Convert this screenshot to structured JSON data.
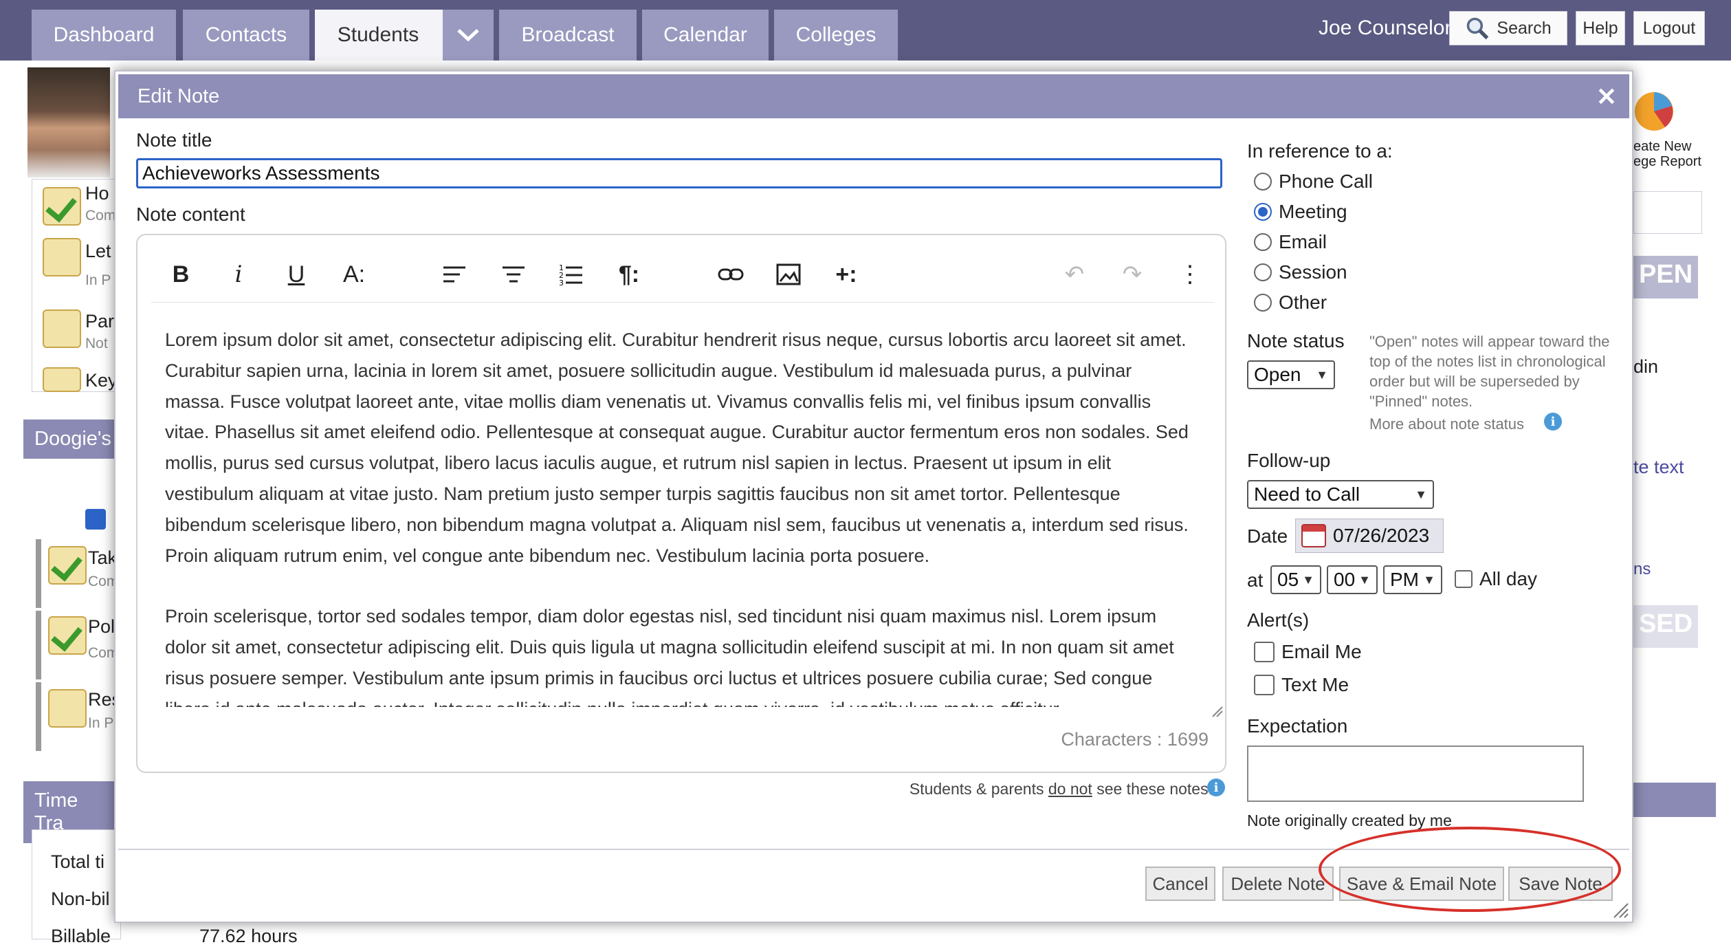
{
  "nav": {
    "tabs": [
      "Dashboard",
      "Contacts",
      "Students",
      "Broadcast",
      "Calendar",
      "Colleges"
    ],
    "active_tab": "Students",
    "user_name": "Joe Counselor",
    "search_label": "Search",
    "help_label": "Help",
    "logout_label": "Logout"
  },
  "background": {
    "tasks_top": [
      {
        "title": "Ho",
        "sub": "Com"
      },
      {
        "title": "Let",
        "sub": "In P"
      },
      {
        "title": "Par",
        "sub": "Not"
      },
      {
        "title": "Key",
        "sub": ""
      }
    ],
    "section2_title": "Doogie's",
    "tasks_mid": [
      {
        "title": "Tak",
        "sub": "Com"
      },
      {
        "title": "Pol",
        "sub": "Com"
      },
      {
        "title": "Res",
        "sub": "In P"
      }
    ],
    "section3_title": "Time Tra",
    "time_rows": [
      "Total ti",
      "Non-bil",
      "Billable",
      "77.62 hours"
    ],
    "right": {
      "report_line1": "eate New",
      "report_line2": "ege Report",
      "open_badge": "PEN",
      "closed_badge": "SED",
      "din_text": "din",
      "te_text": "te text",
      "ns_text": "ns"
    }
  },
  "modal": {
    "title": "Edit Note",
    "close_symbol": "✕",
    "note_title_label": "Note title",
    "note_title_value": "Achieveworks Assessments",
    "note_content_label": "Note content",
    "toolbar_icons": [
      "bold-icon",
      "italic-icon",
      "underline-icon",
      "font-size-icon",
      "align-left-icon",
      "align-center-icon",
      "ordered-list-icon",
      "paragraph-format-icon",
      "link-icon",
      "image-icon",
      "insert-more-icon",
      "undo-icon",
      "redo-icon",
      "more-icon"
    ],
    "content_paragraphs": [
      "Lorem ipsum dolor sit amet, consectetur adipiscing elit. Curabitur hendrerit risus neque, cursus lobortis arcu laoreet sit amet. Curabitur sapien urna, lacinia in lorem sit amet, posuere sollicitudin augue. Vestibulum id malesuada purus, a pulvinar massa. Fusce volutpat laoreet ante, vitae mollis diam venenatis ut. Vivamus convallis felis mi, vel finibus ipsum convallis vitae. Phasellus sit amet eleifend odio. Pellentesque at consequat augue. Curabitur auctor fermentum eros non sodales. Sed mollis, purus sed cursus volutpat, libero lacus iaculis augue, et rutrum nisl sapien in lectus. Praesent ut ipsum in elit vestibulum aliquam at vitae justo. Nam pretium justo semper turpis sagittis faucibus non sit amet tortor. Pellentesque bibendum scelerisque libero, non bibendum magna volutpat a. Aliquam nisl sem, faucibus ut venenatis a, interdum sed risus. Proin aliquam rutrum enim, vel congue ante bibendum nec. Vestibulum lacinia porta posuere.",
      "Proin scelerisque, tortor sed sodales tempor, diam dolor egestas nisl, sed tincidunt nisi quam maximus nisl. Lorem ipsum dolor sit amet, consectetur adipiscing elit. Duis quis ligula ut magna sollicitudin eleifend suscipit at mi. In non quam sit amet risus posuere semper. Vestibulum ante ipsum primis in faucibus orci luctus et ultrices posuere cubilia curae; Sed congue libero id ante malesuada auctor. Integer sollicitudin nulla imperdiet quam viverra, id vestibulum metus efficitur."
    ],
    "char_count": "Characters : 1699",
    "footnote_pre": "Students & parents ",
    "footnote_u": "do not",
    "footnote_post": " see these notes.",
    "reference_label": "In reference to a:",
    "reference_options": [
      "Phone Call",
      "Meeting",
      "Email",
      "Session",
      "Other"
    ],
    "reference_selected": "Meeting",
    "status_label": "Note status",
    "status_value": "Open",
    "status_note": "\"Open\" notes will appear toward the top of the notes list in chronological order but will be superseded by \"Pinned\" notes.",
    "status_more": "More about note status",
    "followup_label": "Follow-up",
    "followup_value": "Need to Call",
    "date_label": "Date",
    "date_value": "07/26/2023",
    "at_label": "at",
    "hour": "05",
    "minute": "00",
    "ampm": "PM",
    "allday_label": "All day",
    "alerts_label": "Alert(s)",
    "alert_email": "Email Me",
    "alert_text": "Text Me",
    "expectation_label": "Expectation",
    "expectation_value": "",
    "created_by": "Note originally created by me",
    "buttons": {
      "cancel": "Cancel",
      "delete": "Delete Note",
      "save_email": "Save & Email Note",
      "save": "Save Note"
    },
    "highlight_color": "#d6302a"
  }
}
